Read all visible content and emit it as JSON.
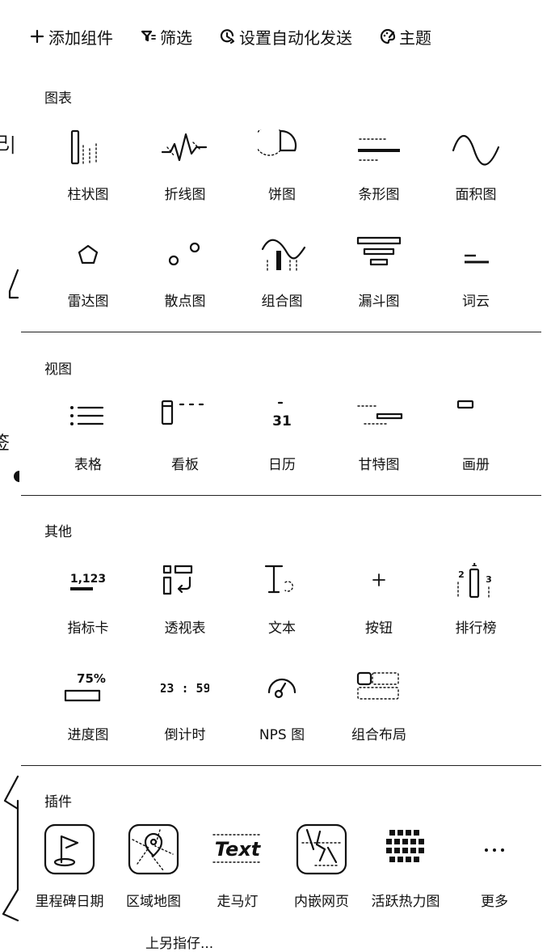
{
  "toolbar": {
    "add_widget": "添加组件",
    "filter": "筛选",
    "auto_send": "设置自动化发送",
    "theme": "主题"
  },
  "left_clip": {
    "text_1": "已|",
    "text_2": "签"
  },
  "sections": {
    "charts": {
      "title": "图表",
      "items": [
        {
          "label": "柱状图",
          "icon": "bar-chart-icon"
        },
        {
          "label": "折线图",
          "icon": "line-chart-icon"
        },
        {
          "label": "饼图",
          "icon": "pie-chart-icon"
        },
        {
          "label": "条形图",
          "icon": "horizontal-bar-chart-icon"
        },
        {
          "label": "面积图",
          "icon": "area-chart-icon"
        },
        {
          "label": "雷达图",
          "icon": "radar-chart-icon"
        },
        {
          "label": "散点图",
          "icon": "scatter-chart-icon"
        },
        {
          "label": "组合图",
          "icon": "combo-chart-icon"
        },
        {
          "label": "漏斗图",
          "icon": "funnel-chart-icon"
        },
        {
          "label": "词云",
          "icon": "word-cloud-icon"
        }
      ]
    },
    "views": {
      "title": "视图",
      "items": [
        {
          "label": "表格",
          "icon": "table-icon"
        },
        {
          "label": "看板",
          "icon": "kanban-icon"
        },
        {
          "label": "日历",
          "icon": "calendar-icon",
          "icon_text": "31"
        },
        {
          "label": "甘特图",
          "icon": "gantt-icon"
        },
        {
          "label": "画册",
          "icon": "gallery-icon"
        }
      ]
    },
    "others": {
      "title": "其他",
      "items": [
        {
          "label": "指标卡",
          "icon": "metric-card-icon",
          "icon_text": "1,123"
        },
        {
          "label": "透视表",
          "icon": "pivot-table-icon"
        },
        {
          "label": "文本",
          "icon": "text-icon"
        },
        {
          "label": "按钮",
          "icon": "button-icon"
        },
        {
          "label": "排行榜",
          "icon": "leaderboard-icon",
          "icon_text": [
            "2",
            "1",
            "3"
          ]
        },
        {
          "label": "进度图",
          "icon": "progress-icon",
          "icon_text": "75%"
        },
        {
          "label": "倒计时",
          "icon": "countdown-icon",
          "icon_text": "23 : 59"
        },
        {
          "label": "NPS 图",
          "icon": "nps-gauge-icon"
        },
        {
          "label": "组合布局",
          "icon": "combined-layout-icon"
        }
      ]
    },
    "plugins": {
      "title": "插件",
      "items": [
        {
          "label": "里程碑日期",
          "icon": "milestone-flag-icon"
        },
        {
          "label": "区域地图",
          "icon": "region-map-icon"
        },
        {
          "label": "走马灯",
          "icon": "marquee-text-icon",
          "icon_text": "Text"
        },
        {
          "label": "内嵌网页",
          "icon": "embedded-webpage-icon"
        },
        {
          "label": "活跃热力图",
          "icon": "activity-heatmap-icon"
        },
        {
          "label": "更多",
          "icon": "more-icon"
        }
      ]
    }
  },
  "bottom_partial_text": "上另指仔..."
}
